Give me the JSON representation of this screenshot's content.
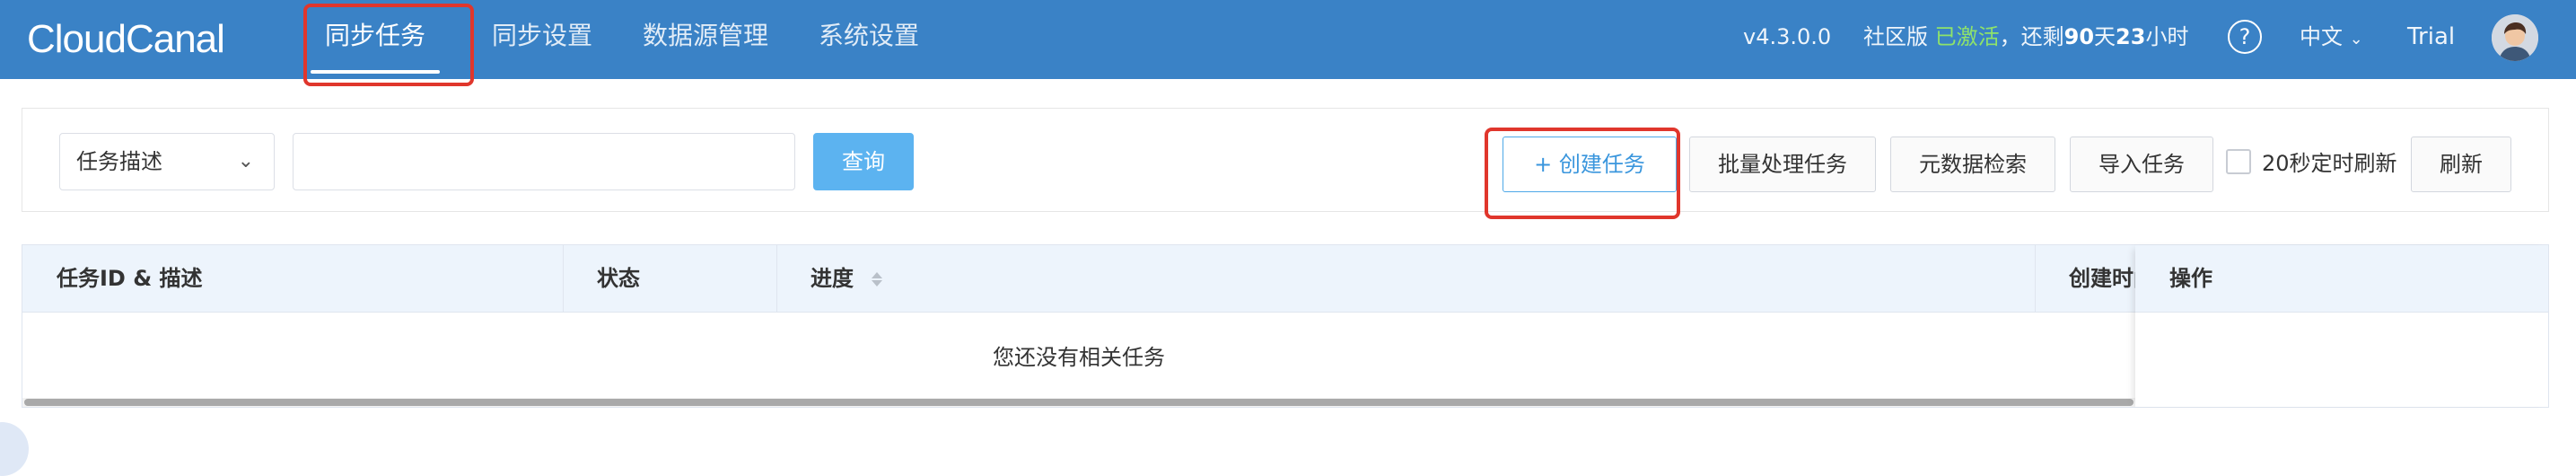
{
  "nav": {
    "logo": "CloudCanal",
    "tabs": [
      {
        "label": "同步任务",
        "active": true
      },
      {
        "label": "同步设置",
        "active": false
      },
      {
        "label": "数据源管理",
        "active": false
      },
      {
        "label": "系统设置",
        "active": false
      }
    ],
    "version": "v4.3.0.0",
    "edition": "社区版",
    "activation_status": "已激活",
    "remaining_prefix": "，还剩",
    "remaining_days": "90",
    "days_unit": "天",
    "remaining_hours": "23",
    "hours_unit": "小时",
    "help_icon": "?",
    "language": "中文",
    "license": "Trial"
  },
  "toolbar": {
    "filter_select": "任务描述",
    "search_value": "",
    "query_label": "查询",
    "create_label": "+ 创建任务",
    "batch_label": "批量处理任务",
    "metadata_label": "元数据检索",
    "import_label": "导入任务",
    "auto_refresh_label": "20秒定时刷新",
    "auto_refresh_checked": false,
    "refresh_label": "刷新"
  },
  "table": {
    "columns": [
      "任务ID & 描述",
      "状态",
      "进度",
      "创建时间",
      "操作"
    ],
    "empty_text": "您还没有相关任务"
  },
  "colors": {
    "nav_bg": "#3a82c6",
    "highlight": "#e0362c",
    "query_btn": "#5cb3f0",
    "activated": "#8fe36a"
  }
}
